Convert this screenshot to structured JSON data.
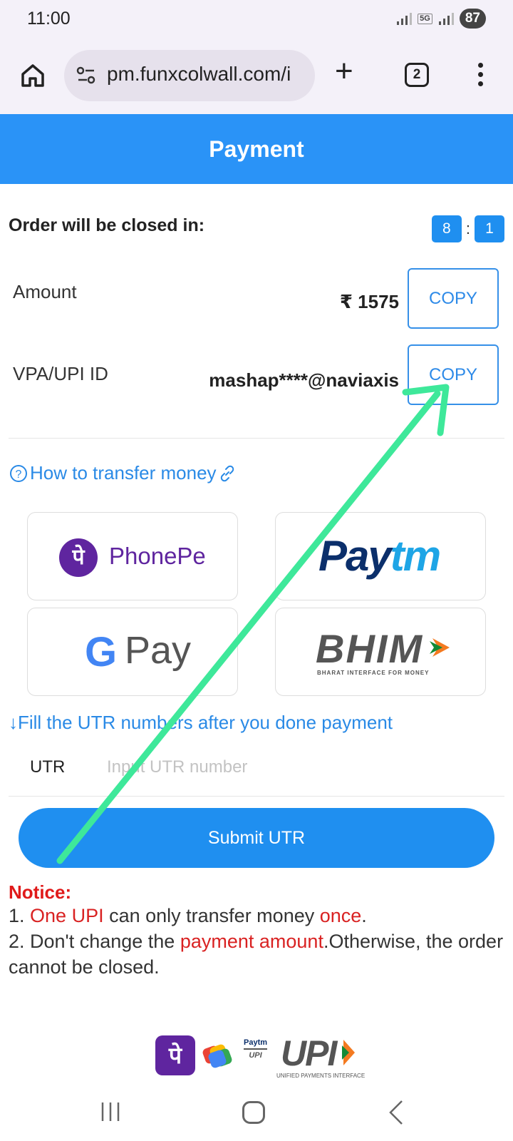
{
  "status_bar": {
    "time": "11:00",
    "network": "5G",
    "battery": "87"
  },
  "browser": {
    "url": "pm.funxcolwall.com/i",
    "tab_count": "2"
  },
  "header": {
    "title": "Payment"
  },
  "order": {
    "label": "Order will be closed in:",
    "timer_digit_1": "8",
    "timer_sep": ":",
    "timer_digit_2": "1"
  },
  "amount": {
    "label": "Amount",
    "value": "₹ 1575",
    "copy_label": "COPY"
  },
  "vpa": {
    "label": "VPA/UPI ID",
    "value": "mashap****@naviaxis",
    "copy_label": "COPY"
  },
  "howto": {
    "label": "How to transfer money"
  },
  "apps": {
    "phonepe": "PhonePe",
    "phonepe_glyph": "पे",
    "paytm_a": "Pay",
    "paytm_b": "tm",
    "gpay_g": "G",
    "gpay_text": "Pay",
    "bhim": "BHIM",
    "bhim_sub": "BHARAT INTERFACE FOR MONEY"
  },
  "utr": {
    "instruction": "↓Fill the UTR numbers after you done payment",
    "label": "UTR",
    "placeholder": "Input UTR number",
    "submit_label": "Submit UTR"
  },
  "notice": {
    "title": "Notice:",
    "line1_a": "1. ",
    "line1_red1": "One UPI",
    "line1_b": " can only transfer money ",
    "line1_red2": "once",
    "line1_c": ".",
    "line2_a": "2. Don't change the ",
    "line2_red": "payment amount",
    "line2_b": ".Otherwise, the order cannot be closed."
  },
  "footer": {
    "phonepe_glyph": "पे",
    "paytm_small_1": "Paytm",
    "paytm_small_2": "UPI",
    "upi": "UPI",
    "upi_sub": "UNIFIED PAYMENTS INTERFACE"
  },
  "colors": {
    "primary": "#1f8ff0",
    "header": "#2a93f7",
    "link": "#2a8ae6",
    "notice_red": "#d92222",
    "annotation_arrow": "#3ee89a"
  }
}
